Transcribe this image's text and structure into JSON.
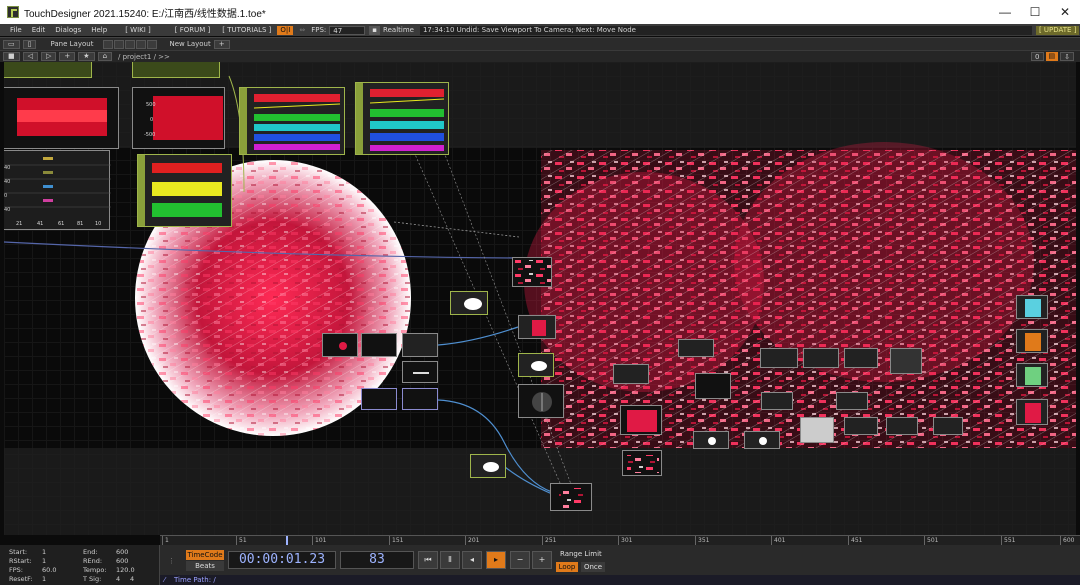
{
  "window": {
    "title": "TouchDesigner 2021.15240: E:/江南西/线性数据.1.toe*",
    "minimize_glyph": "—",
    "maximize_glyph": "☐",
    "close_glyph": "✕"
  },
  "menu": {
    "items": [
      "File",
      "Edit",
      "Dialogs",
      "Help"
    ],
    "wiki": "[ WIKI ]",
    "forum": "[ FORUM ]",
    "tutorials": "[ TUTORIALS ]",
    "oi": "O|I",
    "fps_label": "FPS:",
    "fps_value": "47",
    "realtime": "Realtime",
    "status": "17:34:10 Undid: Save Viewport To Camera; Next: Move Node",
    "update": "[ UPDATE ]"
  },
  "toolbar": {
    "pane_layout": "Pane Layout",
    "new_layout": "New Layout",
    "plus": "+",
    "path": "/ project1 / >>"
  },
  "nodes": {
    "chop_labels": [
      "500",
      "0",
      "-500"
    ],
    "grid_labels": [
      "21",
      "41",
      "61",
      "81",
      "10"
    ],
    "grid_row_labels": [
      "40",
      "40",
      "0",
      "40"
    ]
  },
  "timeline": {
    "ticks": [
      "1",
      "51",
      "101",
      "151",
      "201",
      "251",
      "301",
      "351",
      "401",
      "451",
      "501",
      "551",
      "600"
    ]
  },
  "info": {
    "start_label": "Start:",
    "start_value": "1",
    "rstart_label": "RStart:",
    "rstart_value": "1",
    "fps_label": "FPS:",
    "fps_value": "60.0",
    "resetf_label": "ResetF:",
    "resetf_value": "1",
    "end_label": "End:",
    "end_value": "600",
    "rend_label": "REnd:",
    "rend_value": "600",
    "tempo_label": "Tempo:",
    "tempo_value": "120.0",
    "tsig_label": "T Sig:",
    "tsig_value_a": "4",
    "tsig_value_b": "4"
  },
  "transport": {
    "timecode_btn": "TimeCode",
    "beats_btn": "Beats",
    "timecode": "00:00:01.23",
    "frame": "83",
    "range_limit": "Range Limit",
    "loop": "Loop",
    "once": "Once",
    "minus": "−",
    "plus": "+"
  },
  "pathbar": {
    "text": "Time Path: /"
  },
  "colors": {
    "accent": "#e07a1a",
    "chop": "#9fb54b",
    "particles": "#e0234a"
  }
}
